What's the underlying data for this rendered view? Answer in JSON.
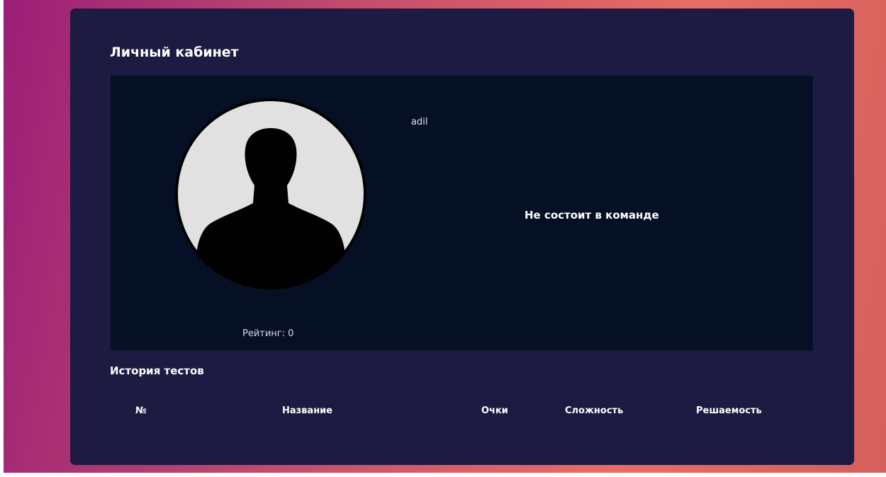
{
  "page_title": "Личный кабинет",
  "profile": {
    "username": "adil",
    "rating_text": "Рейтинг: 0",
    "team_status": "Не состоит в команде",
    "avatar_icon": "user-silhouette-icon"
  },
  "history": {
    "title": "История тестов",
    "columns": [
      "№",
      "Название",
      "Очки",
      "Сложность",
      "Решаемость"
    ],
    "rows": []
  },
  "colors": {
    "card_bg": "#1d1b42",
    "panel_bg": "#061024",
    "gradient_start": "#9c1e78",
    "gradient_end": "#ea6d63",
    "avatar_circle": "#e1e1e1"
  }
}
